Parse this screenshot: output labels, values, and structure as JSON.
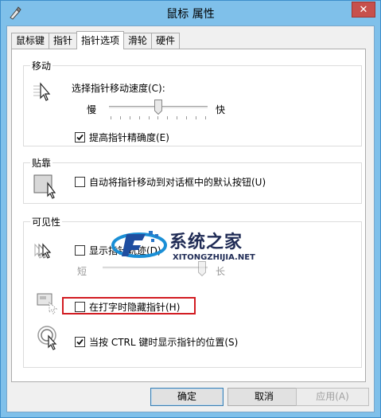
{
  "window": {
    "title": "鼠标 属性",
    "close_label": "✕"
  },
  "tabs": [
    {
      "label": "鼠标键"
    },
    {
      "label": "指针"
    },
    {
      "label": "指针选项"
    },
    {
      "label": "滑轮"
    },
    {
      "label": "硬件"
    }
  ],
  "motion": {
    "legend": "移动",
    "speed_label": "选择指针移动速度(C):",
    "slow_label": "慢",
    "fast_label": "快",
    "speed_value_fraction": 0.5,
    "precision_label": "提高指针精确度(E)",
    "precision_checked": true
  },
  "snap": {
    "legend": "贴靠",
    "snap_label": "自动将指针移动到对话框中的默认按钮(U)",
    "snap_checked": false
  },
  "visibility": {
    "legend": "可见性",
    "trails_label": "显示指针轨迹(D)",
    "trails_checked": false,
    "short_label": "短",
    "long_label": "长",
    "hide_label": "在打字时隐藏指针(H)",
    "hide_checked": false,
    "ctrl_label": "当按 CTRL 键时显示指针的位置(S)",
    "ctrl_checked": true
  },
  "buttons": {
    "ok": "确定",
    "cancel": "取消",
    "apply": "应用(A)"
  },
  "watermark": {
    "cn": "系统之家",
    "en": "XITONGZHIJIA.NET"
  },
  "colors": {
    "highlight": "#d21c22",
    "title_bar": "#7fc0ea"
  }
}
